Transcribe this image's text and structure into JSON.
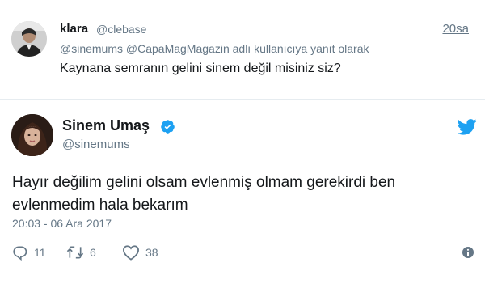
{
  "reply_tweet": {
    "name": "klara",
    "handle": "@clebase",
    "time": "20sa",
    "reply_to": "@sinemums @CapaMagMagazin adlı kullanıcıya yanıt olarak",
    "text": "Kaynana semranın gelini sinem değil misiniz siz?"
  },
  "main_tweet": {
    "name": "Sinem Umaş",
    "handle": "@sinemums",
    "text_line1": "Hayır değilim gelini olsam evlenmiş olmam gerekirdi ben",
    "text_line2": "evlenmedim hala bekarım",
    "date": "20:03 - 06 Ara 2017",
    "replies": "11",
    "retweets": "6",
    "likes": "38"
  },
  "colors": {
    "twitter_blue": "#1da1f2",
    "muted": "#657786",
    "text": "#14171a"
  },
  "icons": [
    "verified-badge-icon",
    "twitter-bird-icon",
    "reply-icon",
    "retweet-icon",
    "heart-icon",
    "info-icon"
  ]
}
